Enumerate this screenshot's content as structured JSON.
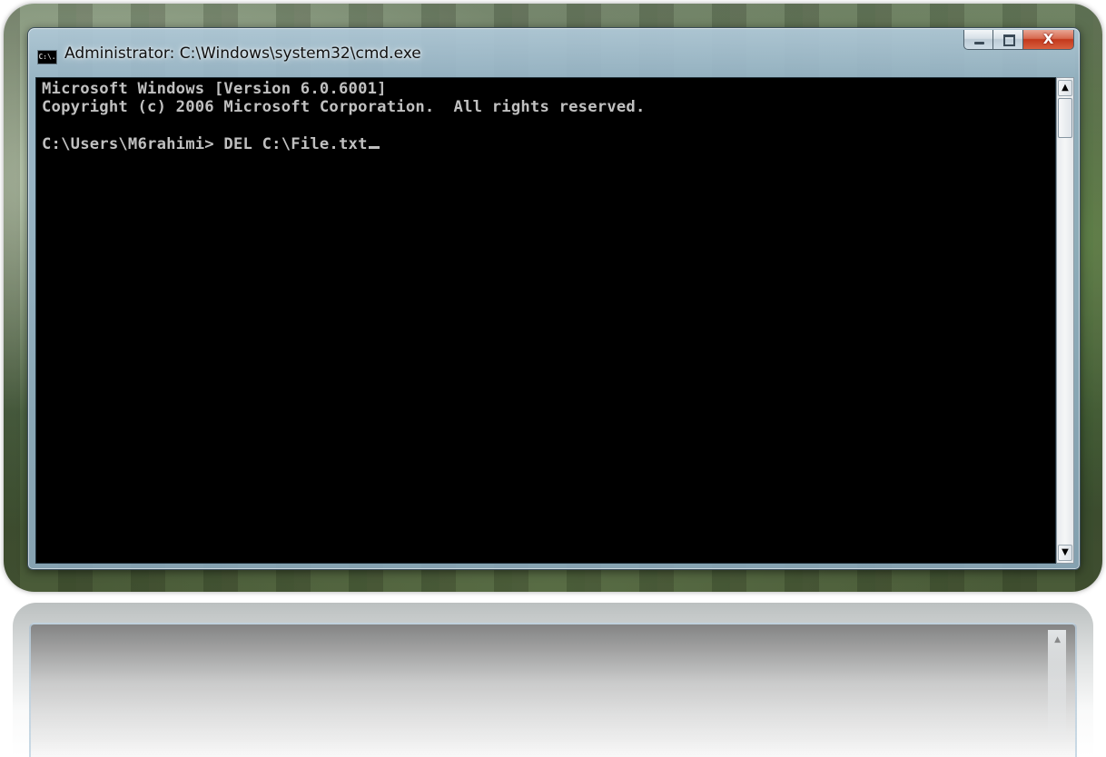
{
  "window": {
    "title": "Administrator: C:\\Windows\\system32\\cmd.exe",
    "app_icon_text": "C:\\.",
    "controls": {
      "close_glyph": "X"
    }
  },
  "console": {
    "lines": [
      "Microsoft Windows [Version 6.0.6001]",
      "Copyright (c) 2006 Microsoft Corporation.  All rights reserved.",
      "",
      "C:\\Users\\M6rahimi> DEL C:\\File.txt"
    ],
    "text_color": "#c0c0c0",
    "background_color": "#000000"
  },
  "scrollbar": {
    "up_arrow": "▲",
    "down_arrow": "▼"
  },
  "icons": {
    "app": "console-icon",
    "minimize": "minimize-icon",
    "maximize": "maximize-icon",
    "close": "close-icon"
  }
}
